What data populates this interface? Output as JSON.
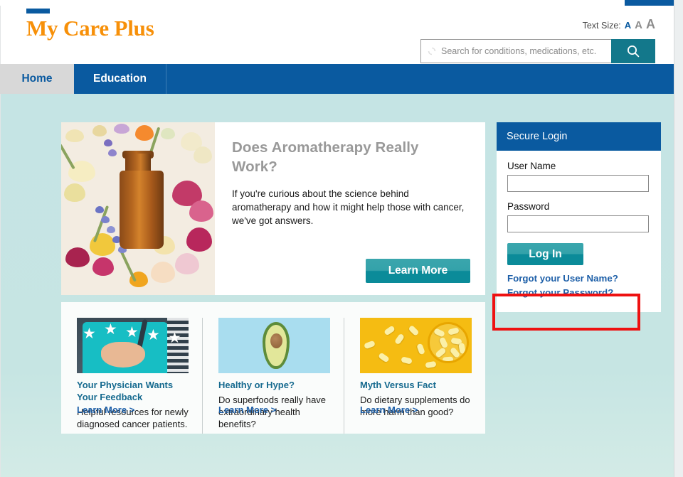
{
  "header": {
    "logo_text": "My Care Plus",
    "text_size_label": "Text Size:",
    "text_size_options": [
      "A",
      "A",
      "A"
    ],
    "search": {
      "placeholder": "Search for conditions, medications, etc.",
      "value": "",
      "button_icon": "search-icon",
      "spinner_icon": "loading-spinner-icon"
    }
  },
  "nav": {
    "tabs": [
      {
        "label": "Home",
        "active": true
      },
      {
        "label": "Education",
        "active": false
      }
    ]
  },
  "hero": {
    "title": "Does Aromatherapy Really Work?",
    "body": "If you're curious about the science behind aromatherapy and how it might help those with cancer, we've got answers.",
    "button_label": "Learn More",
    "image_alt": "aromatherapy-bottle-with-dried-flowers"
  },
  "cards": [
    {
      "title": "Your Physician Wants Your Feedback",
      "text": "Helpful resources for newly diagnosed cancer patients.",
      "link_label": "Learn More >",
      "image_alt": "physician-with-five-stars"
    },
    {
      "title": "Healthy or Hype?",
      "text": "Do superfoods really have extraordinary health benefits?",
      "link_label": "Learn More >",
      "image_alt": "halved-avocado-on-blue"
    },
    {
      "title": "Myth Versus Fact",
      "text": "Do dietary supplements do more harm than good?",
      "link_label": "Learn More >",
      "image_alt": "yellow-capsules-in-bowl"
    }
  ],
  "login": {
    "panel_title": "Secure Login",
    "username_label": "User Name",
    "username_value": "",
    "password_label": "Password",
    "password_value": "",
    "submit_label": "Log In",
    "forgot_username_label": "Forgot your User Name?",
    "forgot_password_label": "Forgot your Password?"
  },
  "annotation": {
    "highlight_target": "forgot-your-password-link",
    "color": "#ee1111"
  },
  "colors": {
    "brand_blue": "#0a5aa0",
    "brand_orange": "#f79009",
    "teal_button": "#0b8b99",
    "page_background": "#c5e4e4",
    "link_blue": "#1d5fa8",
    "card_title_blue": "#166a8f"
  }
}
